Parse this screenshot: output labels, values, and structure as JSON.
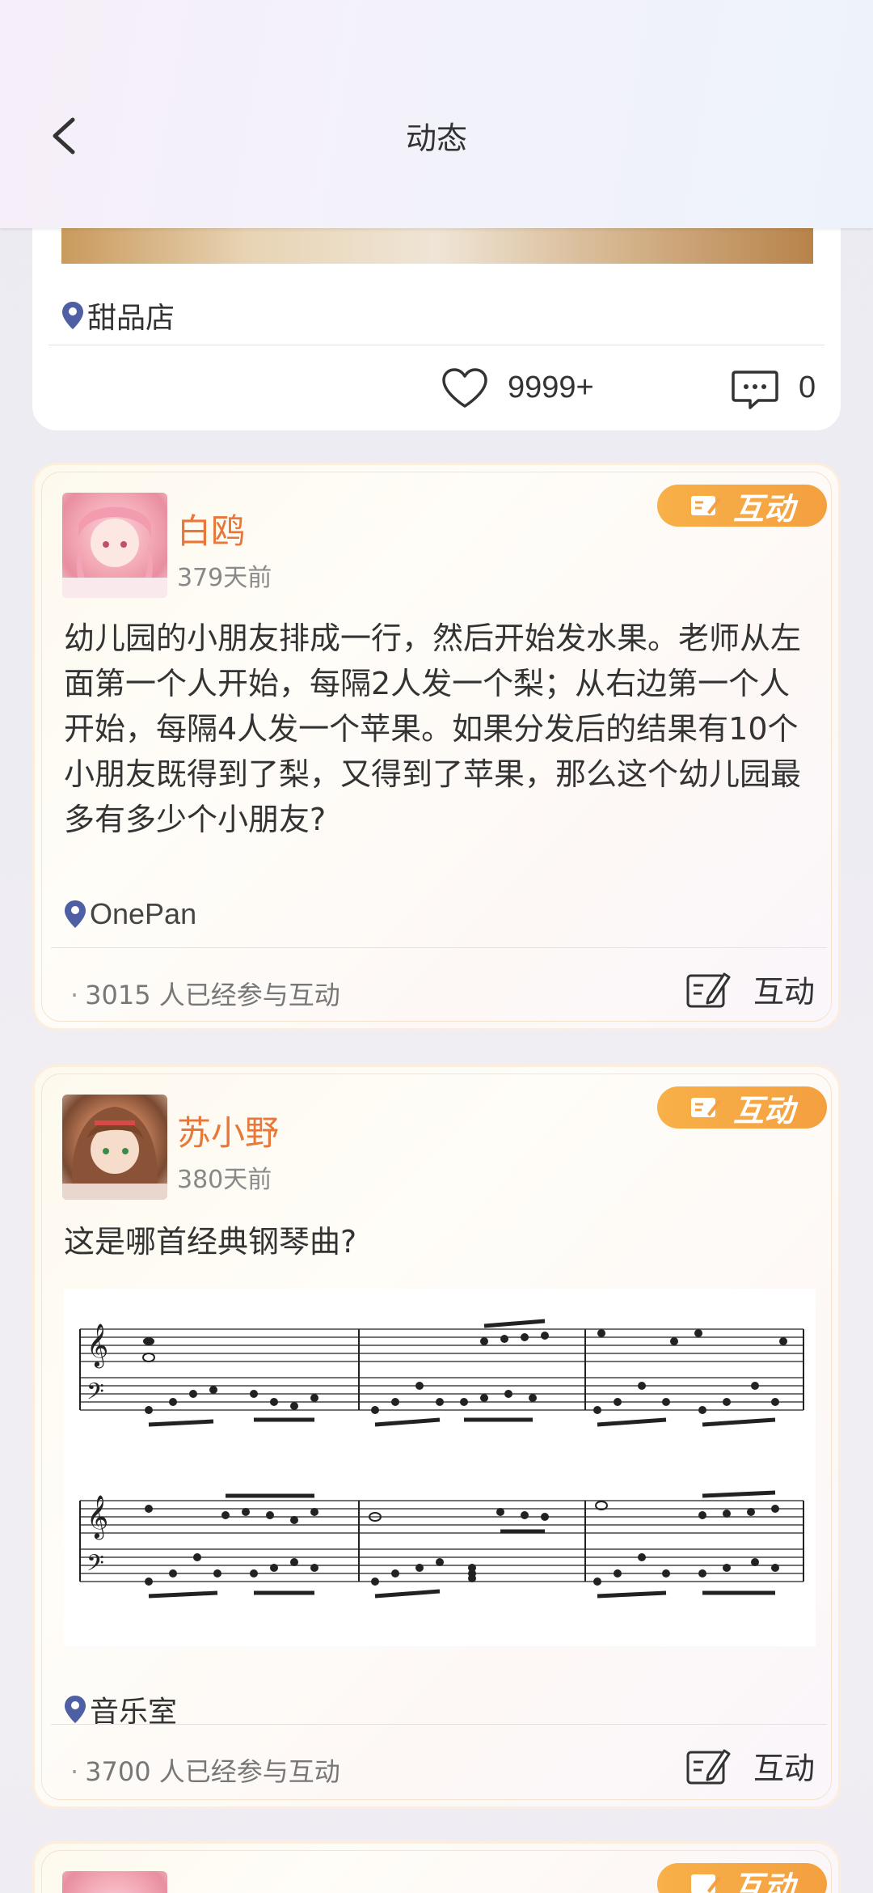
{
  "header": {
    "title": "动态"
  },
  "card1": {
    "location": "甜品店",
    "likes": "9999+",
    "comments": "0"
  },
  "posts": [
    {
      "username": "白鸥",
      "time": "379天前",
      "badge": "互动",
      "text": "幼儿园的小朋友排成一行，然后开始发水果。老师从左面第一个人开始，每隔2人发一个梨；从右边第一个人开始，每隔4人发一个苹果。如果分发后的结果有10个小朋友既得到了梨，又得到了苹果，那么这个幼儿园最多有多少个小朋友?",
      "location": "OnePan",
      "participants": "3015",
      "participants_suffix": "人已经参与互动",
      "action": "互动"
    },
    {
      "username": "苏小野",
      "time": "380天前",
      "badge": "互动",
      "text": "这是哪首经典钢琴曲?",
      "location": "音乐室",
      "participants": "3700",
      "participants_suffix": "人已经参与互动",
      "action": "互动"
    },
    {
      "badge": "互动"
    }
  ]
}
